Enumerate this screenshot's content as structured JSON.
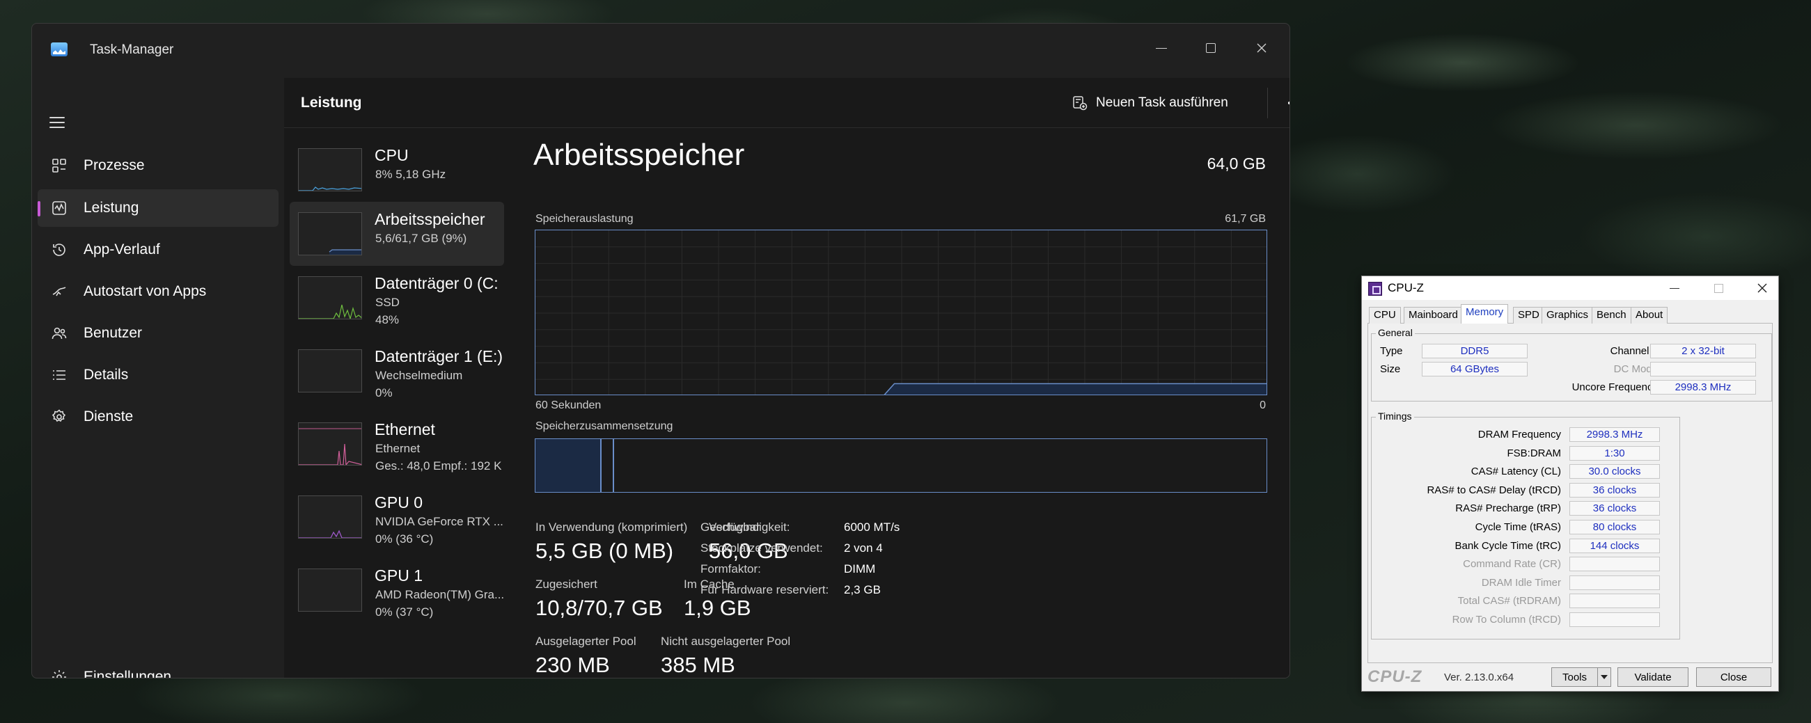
{
  "task_manager": {
    "title": "Task-Manager",
    "nav": {
      "items": [
        {
          "label": "Prozesse",
          "icon": "processes-icon"
        },
        {
          "label": "Leistung",
          "icon": "performance-icon"
        },
        {
          "label": "App-Verlauf",
          "icon": "history-icon"
        },
        {
          "label": "Autostart von Apps",
          "icon": "startup-icon"
        },
        {
          "label": "Benutzer",
          "icon": "users-icon"
        },
        {
          "label": "Details",
          "icon": "details-icon"
        },
        {
          "label": "Dienste",
          "icon": "services-icon"
        }
      ],
      "active": "Leistung",
      "settings_label": "Einstellungen"
    },
    "header": {
      "section_title": "Leistung",
      "run_task_label": "Neuen Task ausführen"
    },
    "perf_items": [
      {
        "name": "CPU",
        "line1": "8%  5,18 GHz",
        "line2": ""
      },
      {
        "name": "Arbeitsspeicher",
        "line1": "5,6/61,7 GB (9%)",
        "line2": ""
      },
      {
        "name": "Datenträger 0 (C:",
        "line1": "SSD",
        "line2": "48%"
      },
      {
        "name": "Datenträger 1 (E:)",
        "line1": "Wechselmedium",
        "line2": "0%"
      },
      {
        "name": "Ethernet",
        "line1": "Ethernet",
        "line2": "Ges.: 48,0  Empf.: 192 K"
      },
      {
        "name": "GPU 0",
        "line1": "NVIDIA GeForce RTX ...",
        "line2": "0%  (36 °C)"
      },
      {
        "name": "GPU 1",
        "line1": "AMD Radeon(TM) Gra...",
        "line2": "0%  (37 °C)"
      }
    ],
    "detail": {
      "title": "Arbeitsspeicher",
      "total": "64,0 GB",
      "graph_label": "Speicherauslastung",
      "graph_max": "61,7 GB",
      "graph_time": "60 Sekunden",
      "graph_min": "0",
      "composition_label": "Speicherzusammensetzung",
      "usage_fraction": 0.09,
      "stats": {
        "in_use_label": "In Verwendung (komprimiert)",
        "in_use_value": "5,5 GB (0 MB)",
        "available_label": "Verfügbar",
        "available_value": "56,0 GB",
        "committed_label": "Zugesichert",
        "committed_value": "10,8/70,7 GB",
        "cached_label": "Im Cache",
        "cached_value": "1,9 GB",
        "paged_pool_label": "Ausgelagerter Pool",
        "paged_pool_value": "230 MB",
        "nonpaged_pool_label": "Nicht ausgelagerter Pool",
        "nonpaged_pool_value": "385 MB"
      },
      "specs": [
        {
          "label": "Geschwindigkeit:",
          "value": "6000 MT/s"
        },
        {
          "label": "Steckplätze verwendet:",
          "value": "2 von 4"
        },
        {
          "label": "Formfaktor:",
          "value": "DIMM"
        },
        {
          "label": "Für Hardware reserviert:",
          "value": "2,3 GB"
        }
      ]
    }
  },
  "cpuz": {
    "title": "CPU-Z",
    "tabs": [
      "CPU",
      "Mainboard",
      "Memory",
      "SPD",
      "Graphics",
      "Bench",
      "About"
    ],
    "active_tab": "Memory",
    "general": {
      "title": "General",
      "type_label": "Type",
      "type_value": "DDR5",
      "size_label": "Size",
      "size_value": "64 GBytes",
      "channel_label": "Channel #",
      "channel_value": "2 x 32-bit",
      "dc_mode_label": "DC Mode",
      "dc_mode_value": "",
      "uncore_label": "Uncore Frequency",
      "uncore_value": "2998.3 MHz"
    },
    "timings": {
      "title": "Timings",
      "rows": [
        {
          "label": "DRAM Frequency",
          "value": "2998.3 MHz",
          "enabled": true
        },
        {
          "label": "FSB:DRAM",
          "value": "1:30",
          "enabled": true
        },
        {
          "label": "CAS# Latency (CL)",
          "value": "30.0 clocks",
          "enabled": true
        },
        {
          "label": "RAS# to CAS# Delay (tRCD)",
          "value": "36 clocks",
          "enabled": true
        },
        {
          "label": "RAS# Precharge (tRP)",
          "value": "36 clocks",
          "enabled": true
        },
        {
          "label": "Cycle Time (tRAS)",
          "value": "80 clocks",
          "enabled": true
        },
        {
          "label": "Bank Cycle Time (tRC)",
          "value": "144 clocks",
          "enabled": true
        },
        {
          "label": "Command Rate (CR)",
          "value": "",
          "enabled": false
        },
        {
          "label": "DRAM Idle Timer",
          "value": "",
          "enabled": false
        },
        {
          "label": "Total CAS# (tRDRAM)",
          "value": "",
          "enabled": false
        },
        {
          "label": "Row To Column (tRCD)",
          "value": "",
          "enabled": false
        }
      ]
    },
    "footer": {
      "logo": "CPU-Z",
      "version": "Ver. 2.13.0.x64",
      "tools_label": "Tools",
      "validate_label": "Validate",
      "close_label": "Close"
    }
  }
}
